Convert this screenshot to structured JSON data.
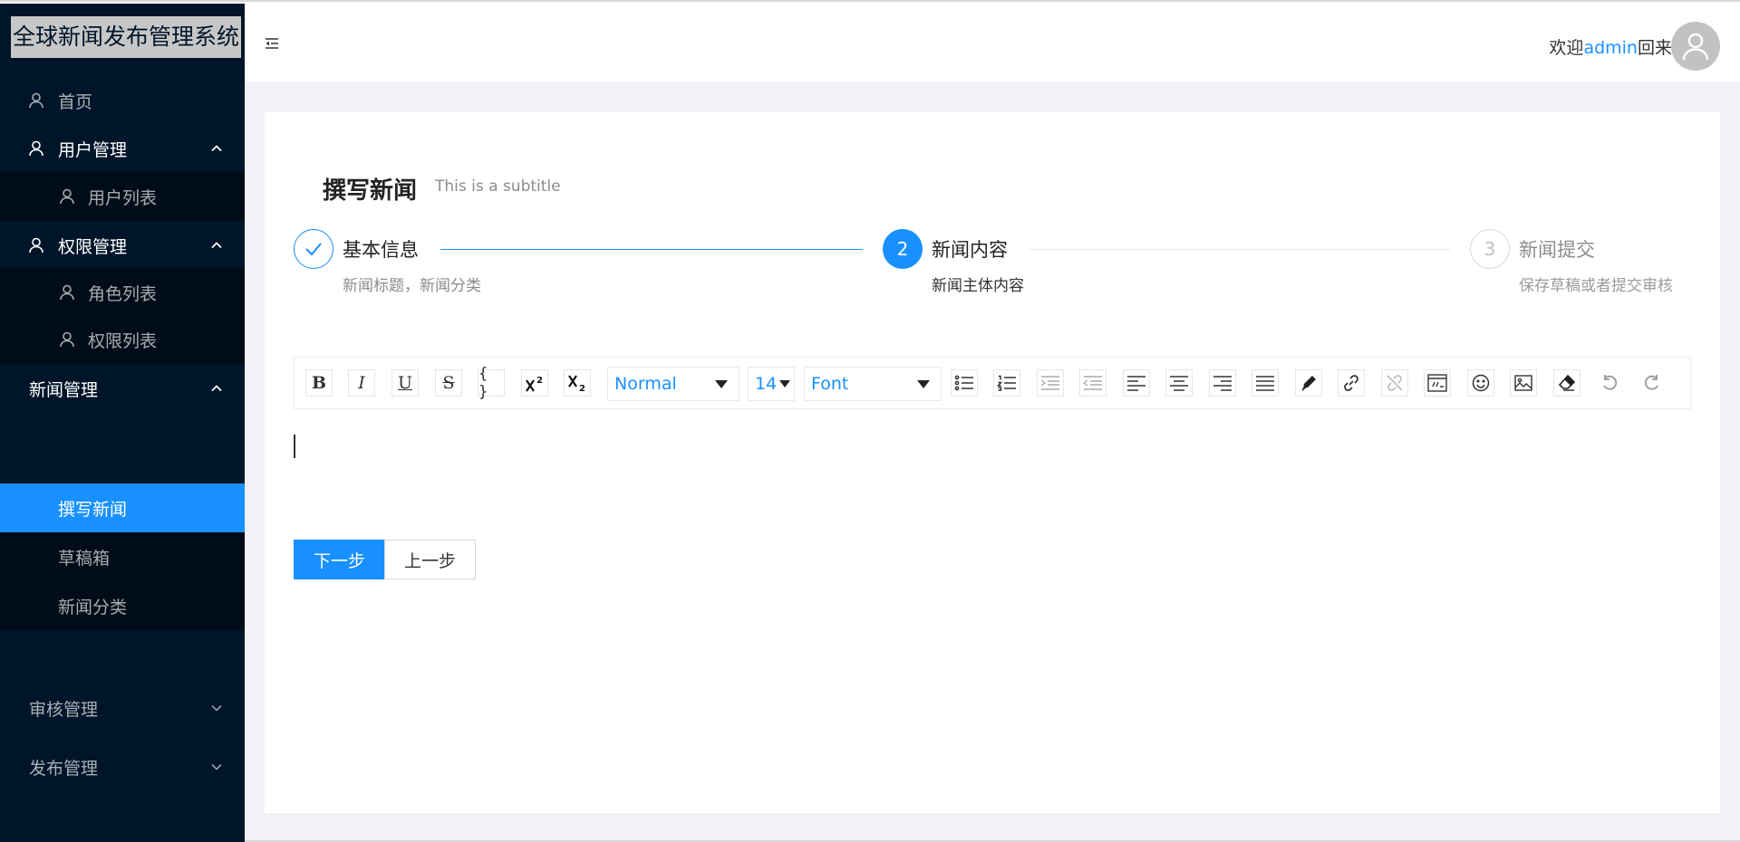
{
  "app": {
    "title": "全球新闻发布管理系统"
  },
  "sidebar": {
    "items": [
      {
        "label": "首页",
        "icon": "user-icon"
      },
      {
        "label": "用户管理",
        "icon": "user-icon",
        "expanded": true
      },
      {
        "label": "用户列表",
        "icon": "user-icon"
      },
      {
        "label": "权限管理",
        "icon": "user-icon",
        "expanded": true
      },
      {
        "label": "角色列表",
        "icon": "user-icon"
      },
      {
        "label": "权限列表",
        "icon": "user-icon"
      },
      {
        "label": "新闻管理",
        "expanded": true
      },
      {
        "label": "撰写新闻",
        "selected": true
      },
      {
        "label": "草稿箱"
      },
      {
        "label": "新闻分类"
      },
      {
        "label": "审核管理",
        "expanded": false
      },
      {
        "label": "发布管理",
        "expanded": false
      }
    ]
  },
  "header": {
    "welcome_prefix": "欢迎",
    "username": "admin",
    "welcome_suffix": "回来",
    "fold_icon": "menu-fold-icon",
    "avatar_icon": "user-avatar-icon"
  },
  "page": {
    "title": "撰写新闻",
    "subtitle": "This is a subtitle"
  },
  "steps": [
    {
      "title": "基本信息",
      "description": "新闻标题，新闻分类",
      "status": "finish"
    },
    {
      "number": "2",
      "title": "新闻内容",
      "description": "新闻主体内容",
      "status": "process"
    },
    {
      "number": "3",
      "title": "新闻提交",
      "description": "保存草稿或者提交审核",
      "status": "wait"
    }
  ],
  "editor": {
    "buttons": {
      "bold": "B",
      "italic": "I",
      "underline": "U",
      "strike": "S",
      "code": "{ }"
    },
    "heading_select": "Normal",
    "size_select": "14",
    "font_select": "Font"
  },
  "actions": {
    "next": "下一步",
    "prev": "上一步"
  },
  "colors": {
    "sider": "#001529",
    "primary": "#1890ff",
    "logo_bg": "#c7c7c7"
  }
}
